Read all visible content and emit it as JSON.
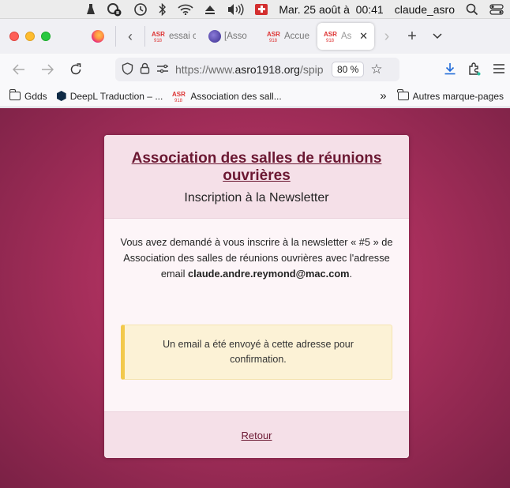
{
  "menubar": {
    "datetime_date": "Mar. 25 août à",
    "datetime_time": "00:41",
    "username": "claude_asro"
  },
  "tabs": [
    {
      "label": "essai c",
      "active": false
    },
    {
      "label": "[Asso",
      "active": false
    },
    {
      "label": "Accue",
      "active": false
    },
    {
      "label": "Ass",
      "active": true
    }
  ],
  "urlbar": {
    "url_prefix": "https://www.",
    "url_domain": "asro1918.org",
    "url_rest": "/spip",
    "zoom": "80 %"
  },
  "bookmarks": {
    "items": [
      "Gdds",
      "DeepL Traduction – ...",
      "Association des sall..."
    ],
    "other": "Autres marque-pages"
  },
  "page": {
    "title": "Association des salles de réunions ouvrières",
    "subtitle": "Inscription à la Newsletter",
    "body_part1": "Vous avez demandé à vous inscrire à la newsletter « #5 » de Association des salles de réunions ouvrières avec l'adresse email ",
    "email": "claude.andre.reymond@mac.com",
    "body_end": ".",
    "alert": "Un email a été envoyé à cette adresse pour confirmation.",
    "back_link": "Retour"
  },
  "colors": {
    "accent": "#6b1832",
    "background": "#a82f5c",
    "alert_border": "#f2c94c"
  }
}
